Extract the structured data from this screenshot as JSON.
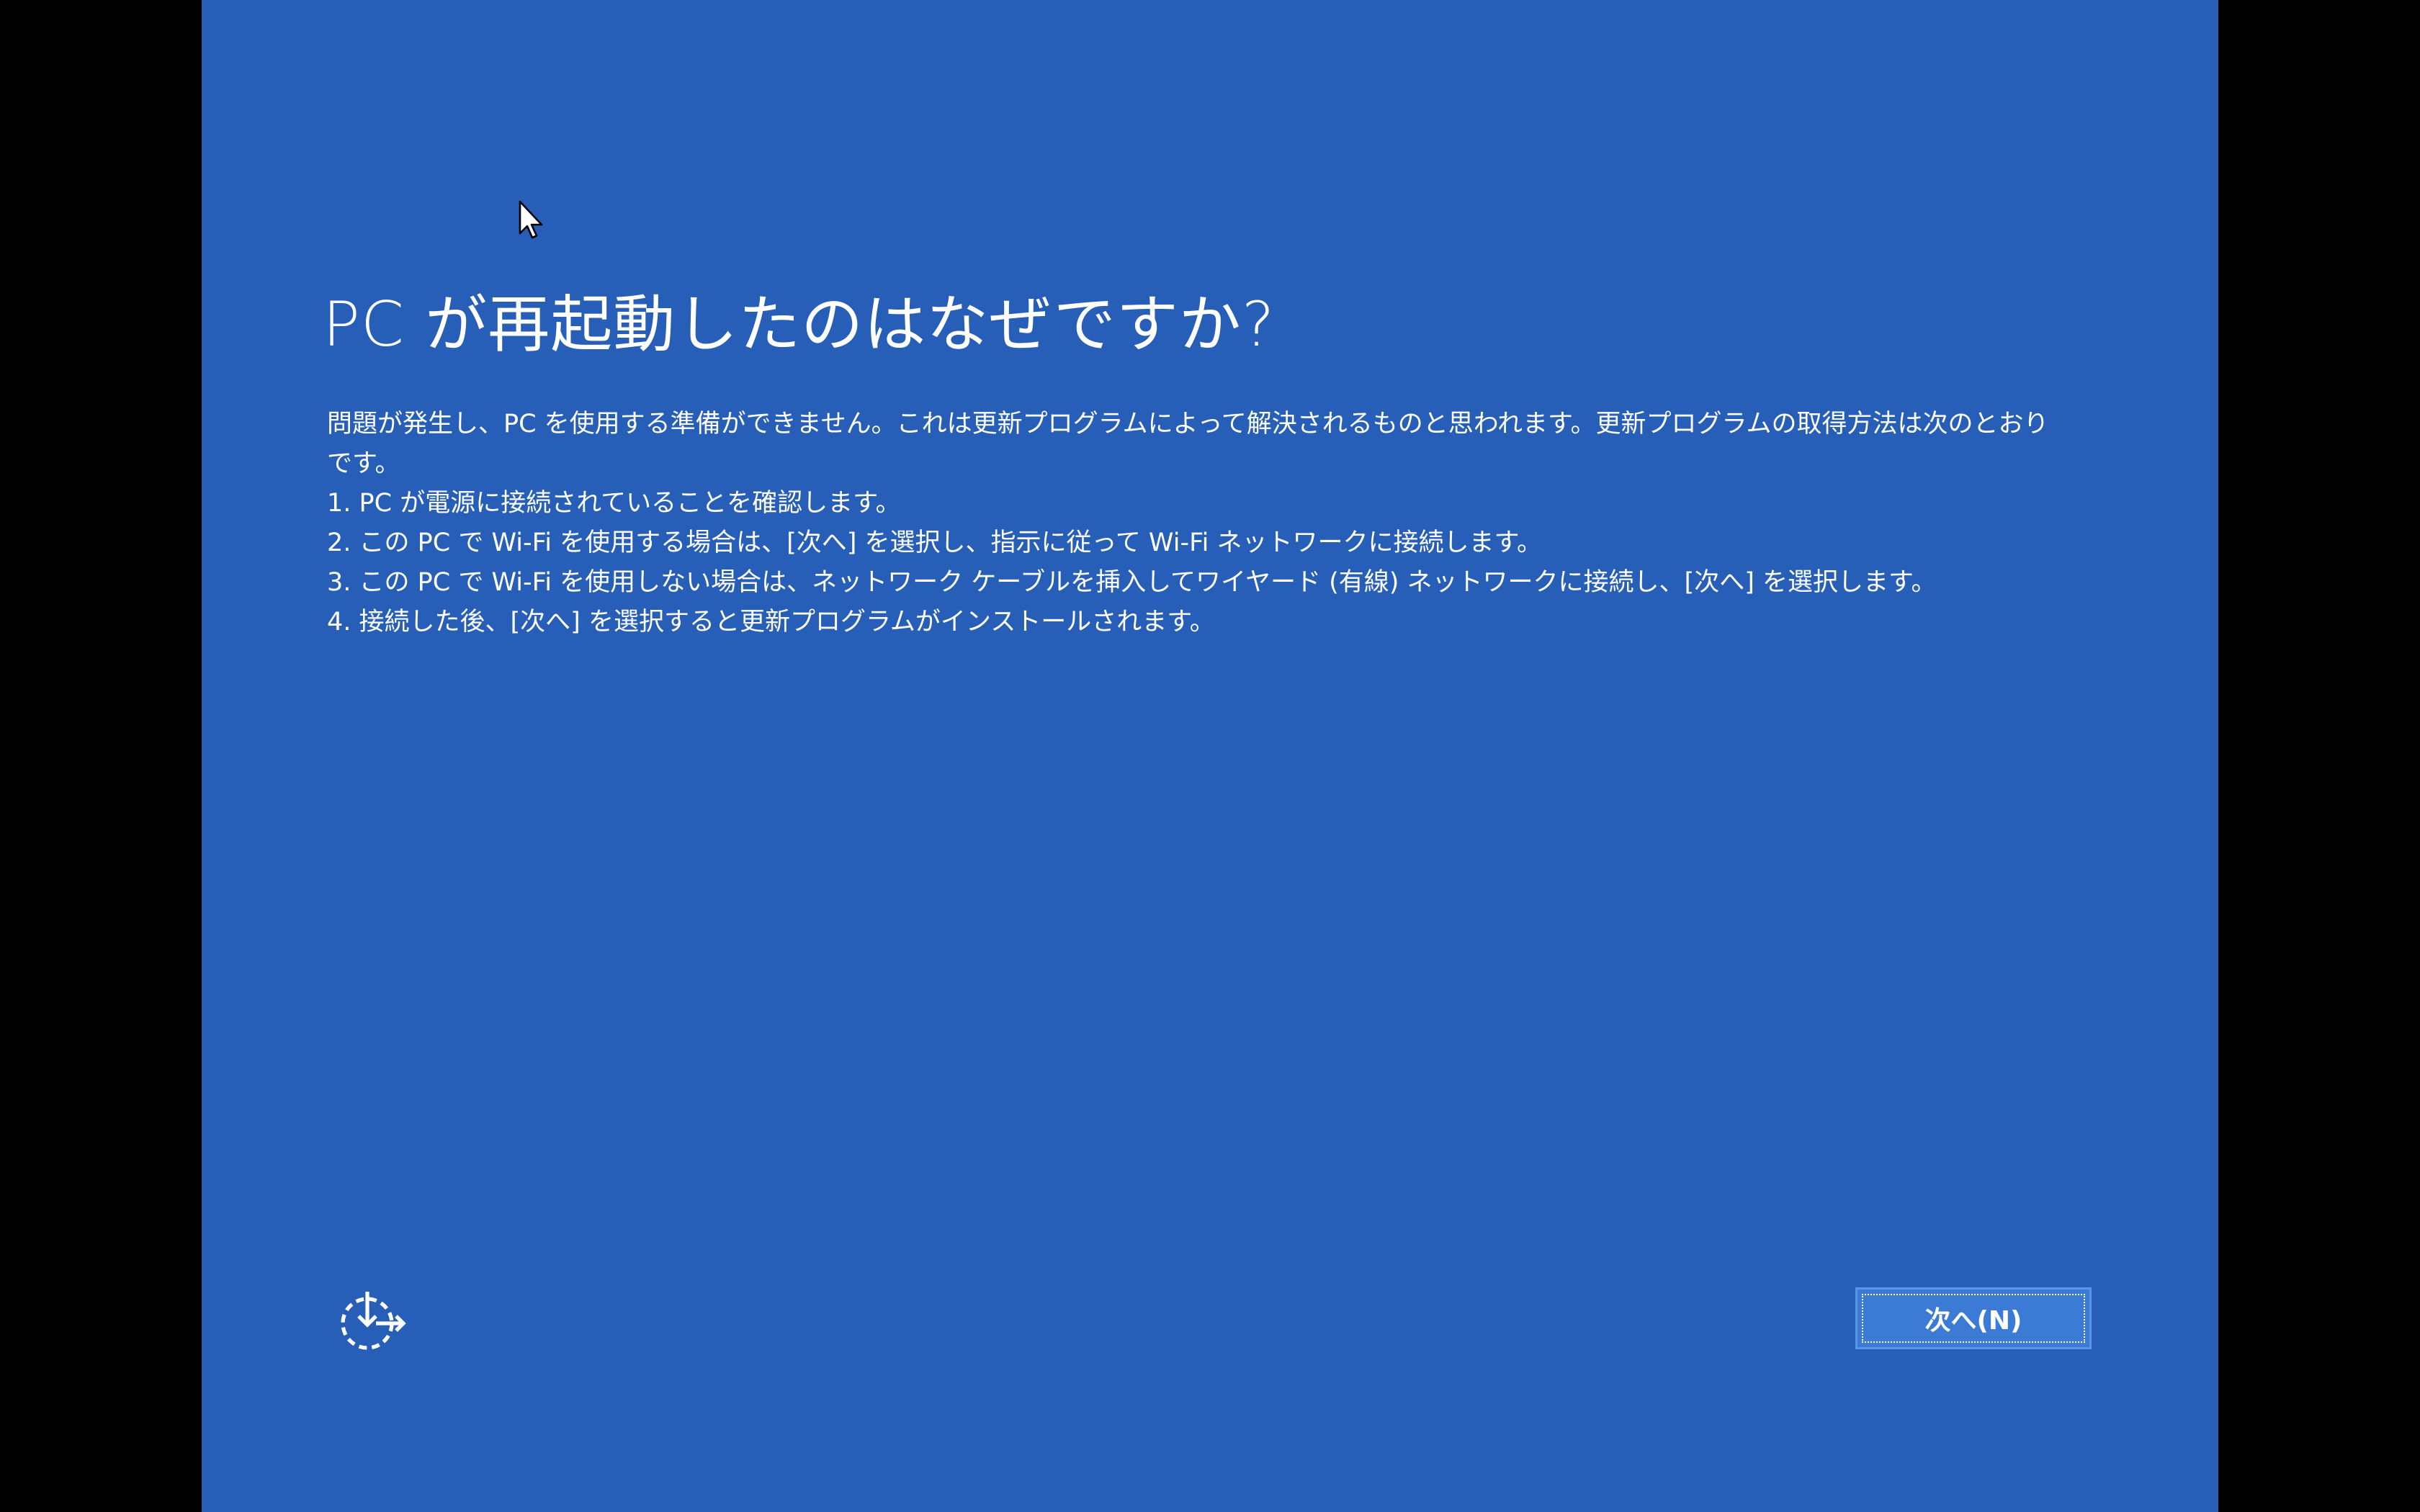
{
  "colors": {
    "panel_background": "#275FB8",
    "outer_background": "#000000",
    "text": "#FFFFFF",
    "button_background": "#3B7BD6",
    "button_border": "#5A96E6"
  },
  "title": "PC が再起動したのはなぜですか?",
  "description": {
    "intro": "問題が発生し、PC を使用する準備ができません。これは更新プログラムによって解決されるものと思われます。更新プログラムの取得方法は次のとおりです。",
    "steps": [
      "1. PC が電源に接続されていることを確認します。",
      "2. この PC で Wi-Fi を使用する場合は、[次へ] を選択し、指示に従って Wi-Fi ネットワークに接続します。",
      "3. この PC で Wi-Fi を使用しない場合は、ネットワーク ケーブルを挿入してワイヤード (有線) ネットワークに接続し、[次へ] を選択します。",
      "4. 接続した後、[次へ] を選択すると更新プログラムがインストールされます。"
    ]
  },
  "accessibility_icon": "ease-of-access-icon",
  "next_button": {
    "label": "次へ(N)"
  },
  "cursor_icon": "mouse-pointer-icon"
}
